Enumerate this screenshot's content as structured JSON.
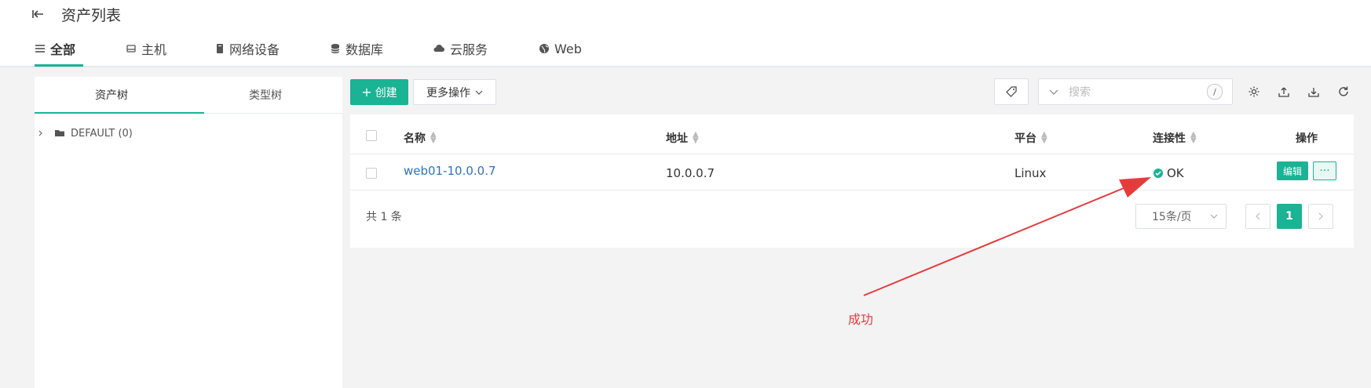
{
  "header": {
    "title": "资产列表"
  },
  "tabs": [
    {
      "label": "全部",
      "icon": "list-icon"
    },
    {
      "label": "主机",
      "icon": "host-icon"
    },
    {
      "label": "网络设备",
      "icon": "network-device-icon"
    },
    {
      "label": "数据库",
      "icon": "database-icon"
    },
    {
      "label": "云服务",
      "icon": "cloud-icon"
    },
    {
      "label": "Web",
      "icon": "globe-icon"
    }
  ],
  "left_panel": {
    "tabs": [
      "资产树",
      "类型树"
    ],
    "tree": [
      {
        "label": "DEFAULT (0)"
      }
    ]
  },
  "toolbar": {
    "create_label": "创建",
    "more_label": "更多操作",
    "search_placeholder": "搜索",
    "search_shortcut": "/"
  },
  "table": {
    "columns": [
      "名称",
      "地址",
      "平台",
      "连接性",
      "操作"
    ],
    "rows": [
      {
        "name": "web01-10.0.0.7",
        "address": "10.0.0.7",
        "platform": "Linux",
        "connectivity": "OK",
        "edit_label": "编辑"
      }
    ],
    "total_label": "共 1 条",
    "page_size": "15条/页",
    "current_page": "1"
  },
  "annotation": {
    "text": "成功"
  },
  "colors": {
    "accent": "#1ab394",
    "link": "#2f73b8",
    "annotation": "#e63b3b"
  }
}
